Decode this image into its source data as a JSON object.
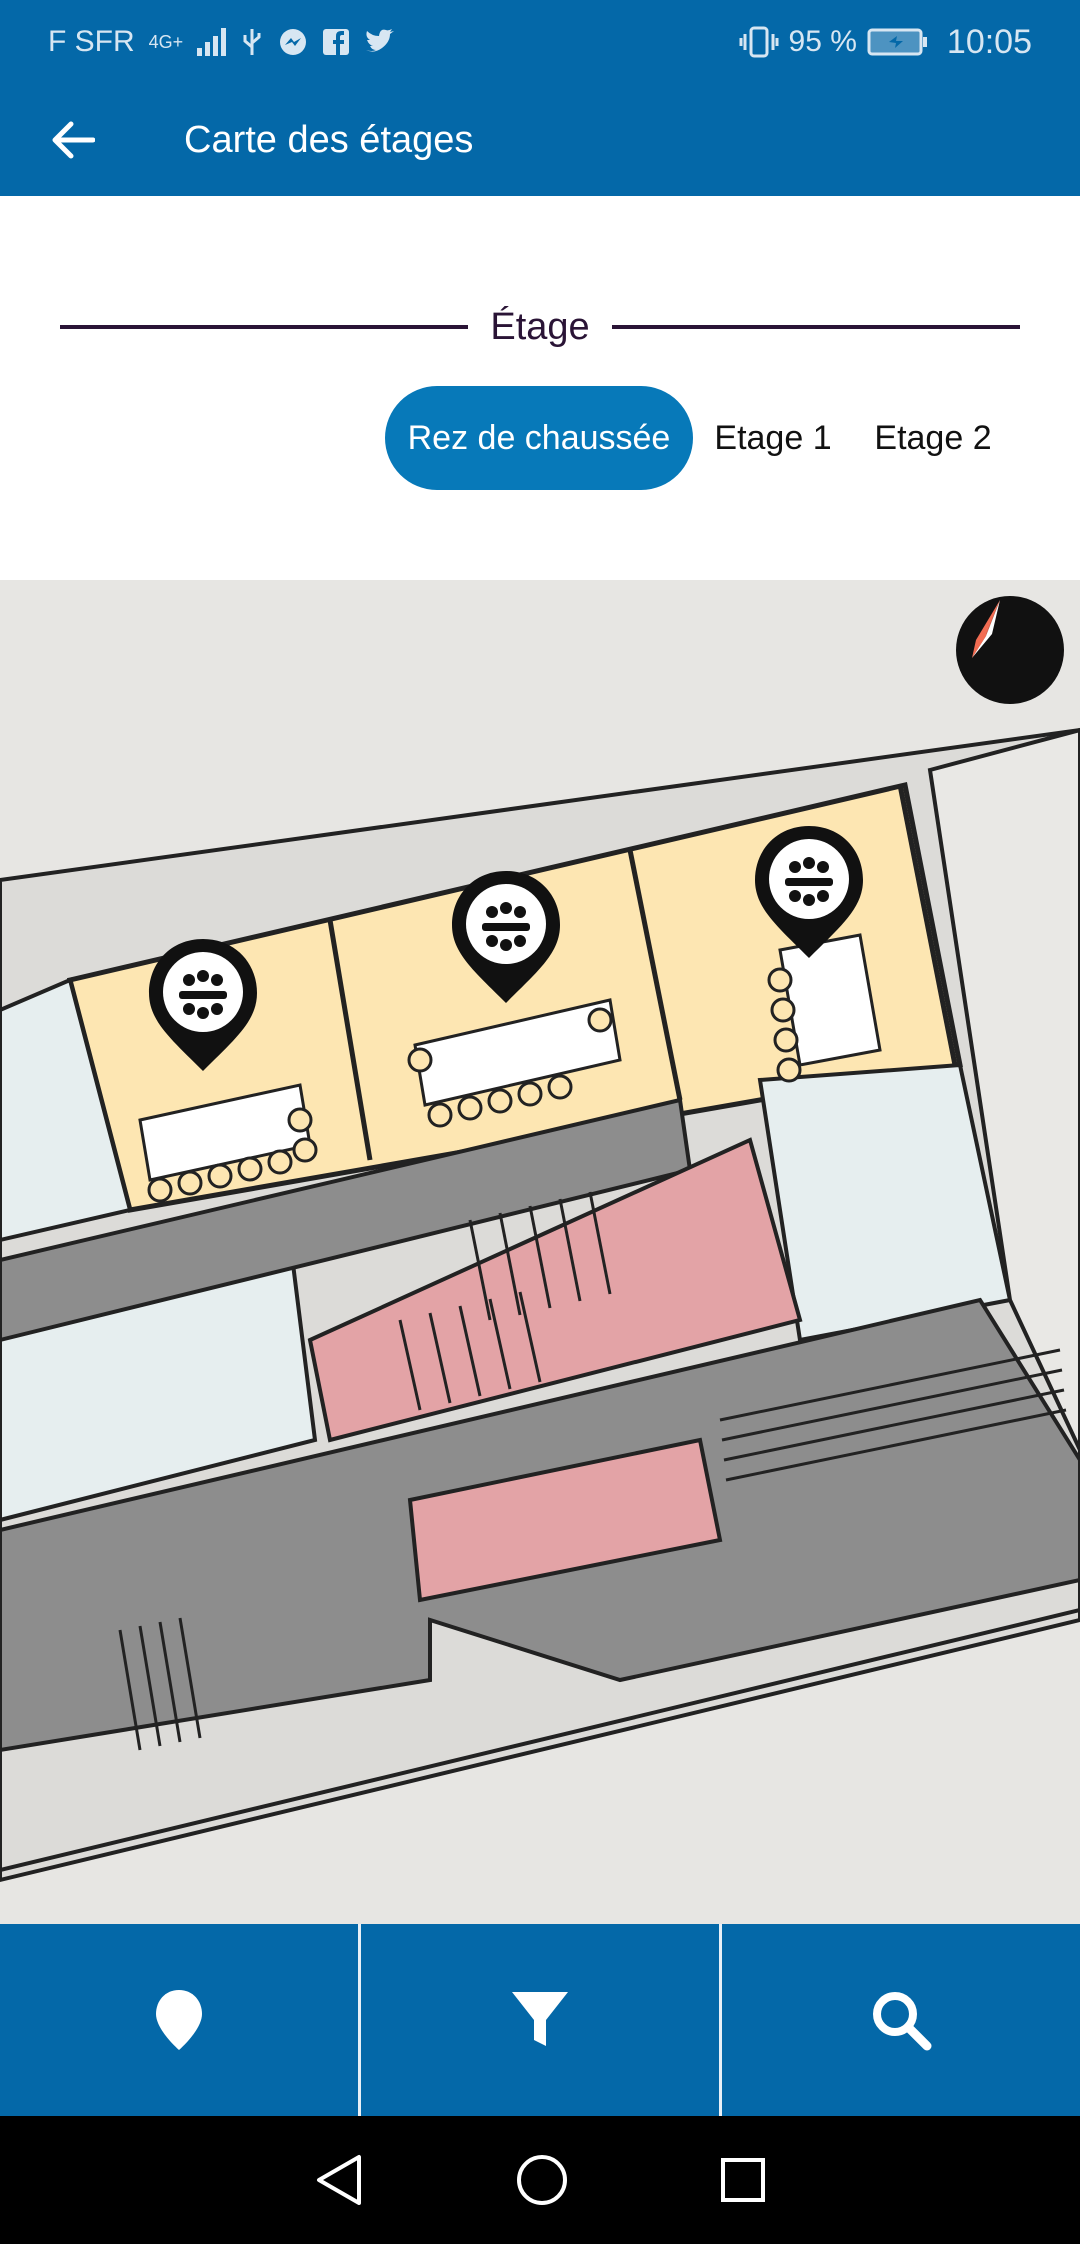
{
  "status_bar": {
    "carrier": "F SFR",
    "network": "4G+",
    "battery_percent": "95 %",
    "time": "10:05"
  },
  "app_bar": {
    "title": "Carte des étages"
  },
  "floor_selector": {
    "heading": "Étage",
    "tabs": [
      {
        "label": "Rez de chaussée",
        "selected": true
      },
      {
        "label": "Etage 1",
        "selected": false
      },
      {
        "label": "Etage 2",
        "selected": false
      }
    ]
  },
  "map": {
    "markers": [
      {
        "icon": "meeting-room-icon"
      },
      {
        "icon": "meeting-room-icon"
      },
      {
        "icon": "meeting-room-icon"
      }
    ],
    "compass_icon": "compass-icon"
  },
  "bottom_nav": {
    "items": [
      {
        "icon": "location-pin-icon"
      },
      {
        "icon": "filter-icon"
      },
      {
        "icon": "search-icon"
      }
    ]
  },
  "system_nav": {
    "items": [
      {
        "icon": "back-triangle-icon"
      },
      {
        "icon": "home-circle-icon"
      },
      {
        "icon": "recents-square-icon"
      }
    ]
  },
  "colors": {
    "primary": "#0468a8",
    "tab_active": "#0779b9",
    "room_yellow": "#fde6b2",
    "room_pink": "#e3a3a6",
    "corridor_gray": "#8d8d8d",
    "room_light": "#e6eeef",
    "compass_red": "#f26c52"
  }
}
